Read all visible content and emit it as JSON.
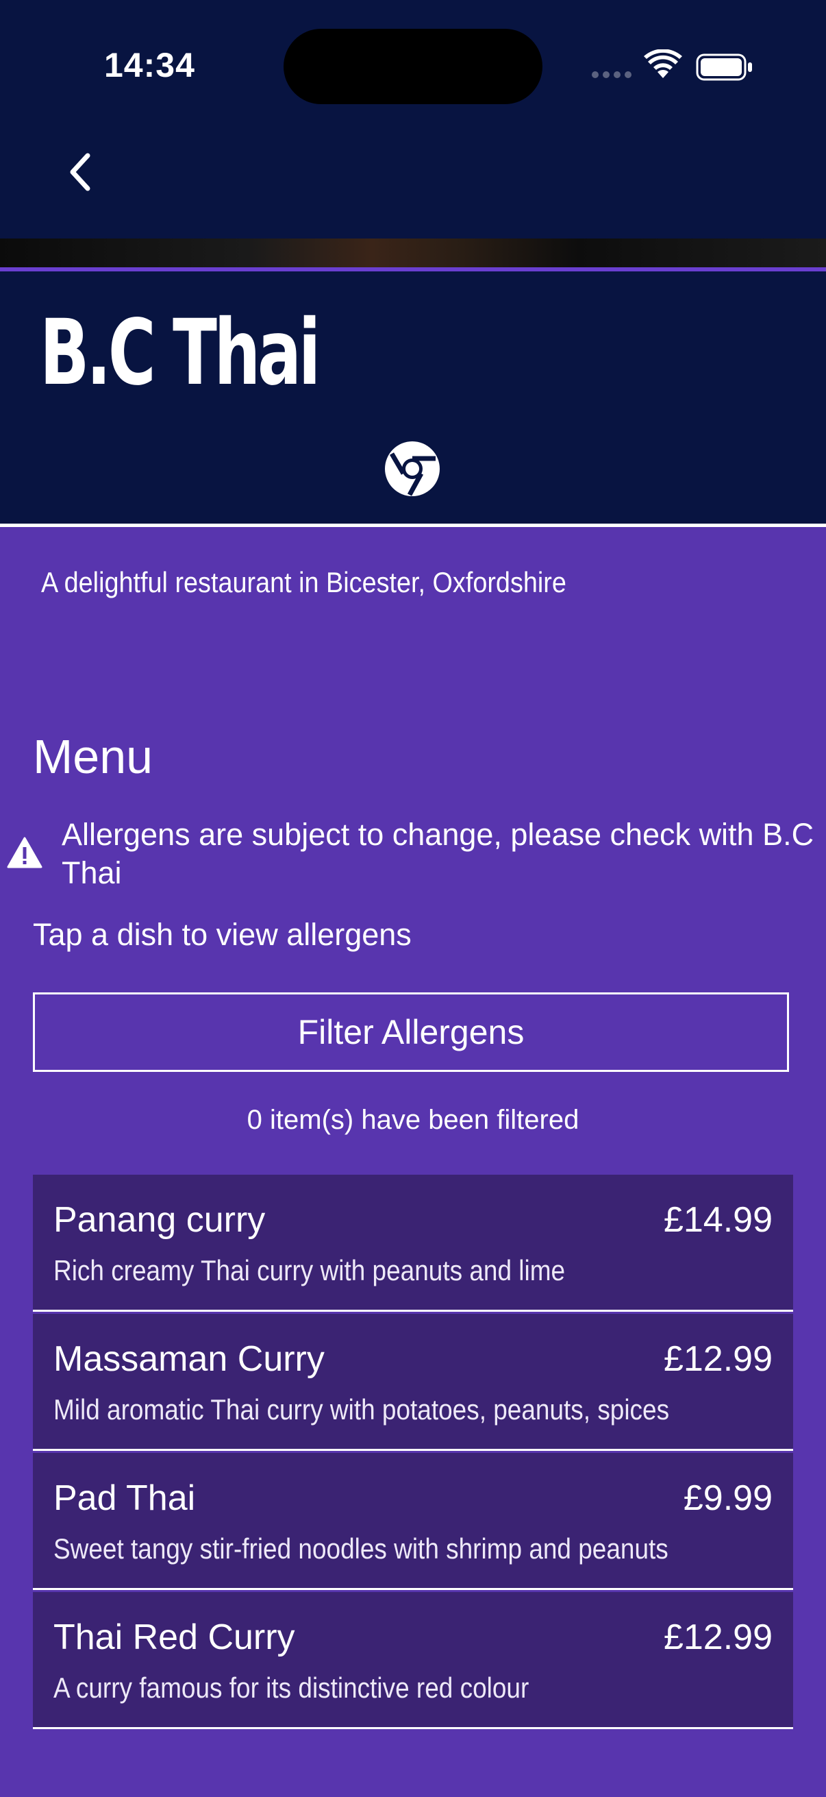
{
  "status_bar": {
    "time": "14:34"
  },
  "restaurant": {
    "name": "B.C Thai",
    "tagline": "A delightful restaurant in Bicester, Oxfordshire"
  },
  "menu": {
    "heading": "Menu",
    "allergen_warning": "Allergens are subject to change, please check with B.C Thai",
    "tap_hint": "Tap a dish to view allergens",
    "filter_button": "Filter Allergens",
    "filtered_count": "0 item(s) have been filtered",
    "items": [
      {
        "name": "Panang curry",
        "price": "£14.99",
        "description": "Rich creamy Thai curry with peanuts and lime"
      },
      {
        "name": "Massaman Curry",
        "price": "£12.99",
        "description": "Mild aromatic Thai curry with potatoes, peanuts, spices"
      },
      {
        "name": "Pad Thai",
        "price": "£9.99",
        "description": "Sweet tangy stir-fried noodles with shrimp and peanuts"
      },
      {
        "name": "Thai Red Curry",
        "price": "£12.99",
        "description": "A curry famous for its distinctive red colour"
      }
    ]
  },
  "icons": {
    "back": "chevron-left-icon",
    "website": "chrome-icon",
    "warning": "warning-triangle-icon",
    "wifi": "wifi-icon",
    "battery": "battery-icon"
  },
  "colors": {
    "header_bg": "#081441",
    "page_bg": "#5835AE",
    "card_bg": "#3B2373",
    "text": "#ffffff"
  }
}
